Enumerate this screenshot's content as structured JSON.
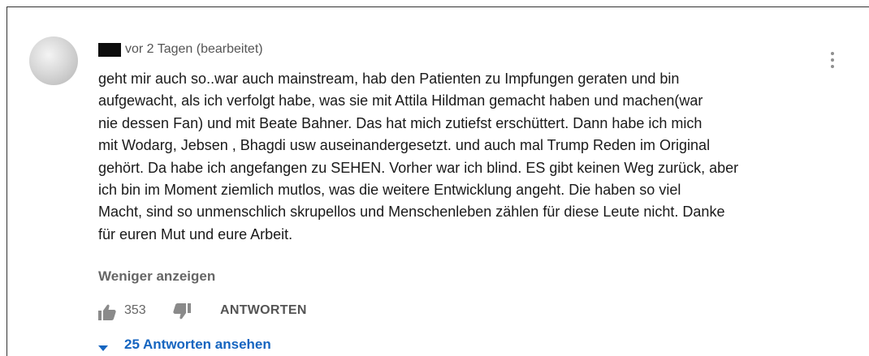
{
  "comment": {
    "timestamp": "vor 2 Tagen (bearbeitet)",
    "lines": [
      "geht mir auch so..war auch mainstream, hab den Patienten zu Impfungen geraten und bin",
      "aufgewacht, als ich verfolgt habe, was sie mit Attila Hildman gemacht haben und machen(war",
      "nie dessen Fan) und mit Beate Bahner. Das hat mich zutiefst erschüttert. Dann habe ich mich",
      "mit Wodarg, Jebsen , Bhagdi usw auseinandergesetzt. und auch  mal Trump Reden im Original",
      "gehört. Da habe ich angefangen zu SEHEN. Vorher war ich blind. ES gibt keinen Weg zurück, aber",
      "ich bin im Moment ziemlich mutlos, was die weitere Entwicklung angeht. Die haben so viel",
      "Macht, sind so unmenschlich skrupellos und Menschenleben zählen für diese Leute nicht. Danke",
      "für euren Mut und eure Arbeit."
    ],
    "show_less_label": "Weniger anzeigen",
    "like_count": "353",
    "reply_label": "ANTWORTEN",
    "view_replies_label": "25 Antworten ansehen"
  },
  "icons": {
    "avatar": "avatar-placeholder",
    "like": "thumb-up-icon",
    "dislike": "thumb-down-icon",
    "replies_toggle": "chevron-down-icon",
    "menu": "more-vertical-icon"
  },
  "colors": {
    "link_blue": "#1565c0",
    "muted_text": "#666666",
    "body_text": "#1a1a1a"
  }
}
